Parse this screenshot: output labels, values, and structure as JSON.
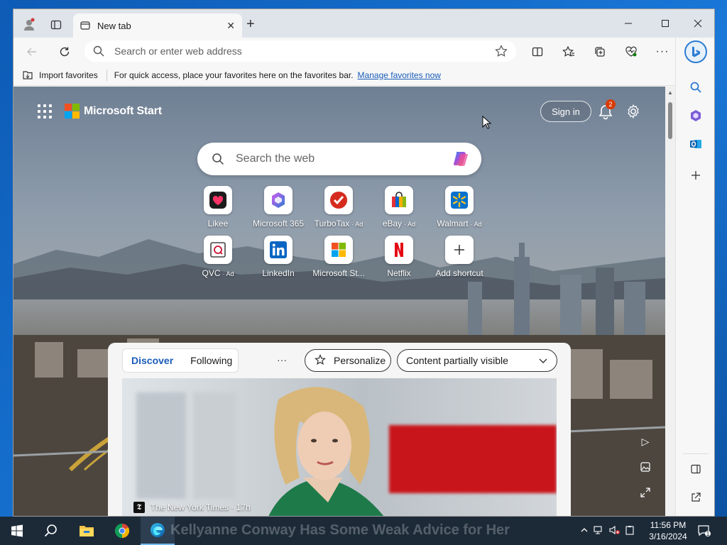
{
  "browser": {
    "tab_title": "New tab",
    "address_placeholder": "Search or enter web address"
  },
  "favorites_bar": {
    "import_label": "Import favorites",
    "hint": "For quick access, place your favorites here on the favorites bar.",
    "manage_link": "Manage favorites now"
  },
  "start": {
    "brand": "Microsoft Start",
    "signin_label": "Sign in",
    "notification_count": "2",
    "search_placeholder": "Search the web",
    "shortcuts": [
      {
        "label": "Likee",
        "ad": ""
      },
      {
        "label": "Microsoft 365",
        "ad": ""
      },
      {
        "label": "TurboTax",
        "ad": "Ad"
      },
      {
        "label": "eBay",
        "ad": "Ad"
      },
      {
        "label": "Walmart",
        "ad": "Ad"
      },
      {
        "label": "QVC",
        "ad": "Ad"
      },
      {
        "label": "LinkedIn",
        "ad": ""
      },
      {
        "label": "Microsoft St...",
        "ad": ""
      },
      {
        "label": "Netflix",
        "ad": ""
      },
      {
        "label": "Add shortcut",
        "ad": ""
      }
    ]
  },
  "feed": {
    "tab_discover": "Discover",
    "tab_following": "Following",
    "more": "···",
    "personalize_label": "Personalize",
    "visibility_label": "Content partially visible",
    "hero_source": "The New York Times · 17h",
    "hero_headline": "Kellyanne Conway Has Some Weak Advice for Her"
  },
  "taskbar": {
    "time": "11:56 PM",
    "date": "3/16/2024",
    "notification_count": "1"
  },
  "colors": {
    "accent": "#1a5cb8",
    "badge": "#d83b01",
    "taskbar": "#1c2a38"
  }
}
